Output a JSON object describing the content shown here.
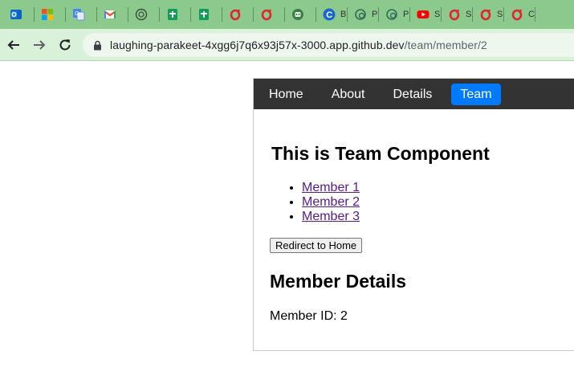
{
  "browser": {
    "tabs": [
      {
        "icon": "outlook-icon",
        "title": ""
      },
      {
        "icon": "microsoft-icon",
        "title": ""
      },
      {
        "icon": "translate-icon",
        "title": ""
      },
      {
        "icon": "gmail-icon",
        "title": ""
      },
      {
        "icon": "chatgpt-icon",
        "title": ""
      },
      {
        "icon": "sheets-icon",
        "title": ""
      },
      {
        "icon": "sheets-icon",
        "title": ""
      },
      {
        "icon": "opera-icon",
        "title": ""
      },
      {
        "icon": "opera-icon",
        "title": ""
      },
      {
        "icon": "robot-icon",
        "title": ""
      },
      {
        "icon": "c-icon",
        "title": "B"
      },
      {
        "icon": "swirl-icon",
        "title": "P"
      },
      {
        "icon": "swirl-icon",
        "title": "P"
      },
      {
        "icon": "youtube-icon",
        "title": "S"
      },
      {
        "icon": "opera-icon",
        "title": "S"
      },
      {
        "icon": "opera-icon",
        "title": "S"
      },
      {
        "icon": "opera-icon",
        "title": "C"
      }
    ],
    "url_host": "laughing-parakeet-4xgg6j7q6x93j57x-3000.app.github.dev",
    "url_path": "/team/member/2"
  },
  "nav": {
    "items": [
      {
        "label": "Home",
        "active": false
      },
      {
        "label": "About",
        "active": false
      },
      {
        "label": "Details",
        "active": false
      },
      {
        "label": "Team",
        "active": true
      }
    ]
  },
  "team": {
    "heading": "This is Team Component",
    "members": [
      "Member 1",
      "Member 2",
      "Member 3"
    ],
    "redirect_label": "Redirect to Home"
  },
  "details": {
    "heading": "Member Details",
    "id_text": "Member ID: 2"
  }
}
